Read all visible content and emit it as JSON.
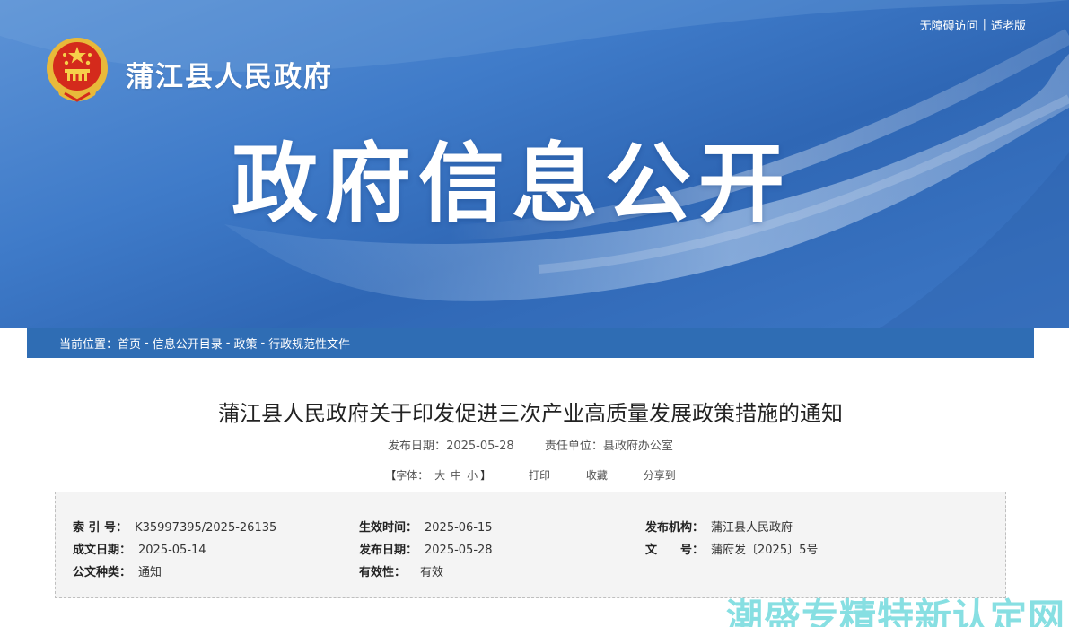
{
  "header": {
    "accessibility_link": "无障碍访问",
    "separator": "|",
    "elder_link": "适老版",
    "site_name": "蒲江县人民政府",
    "hero_title": "政府信息公开",
    "emblem_icon": "national-emblem-icon"
  },
  "breadcrumb": {
    "label": "当前位置：",
    "items": [
      "首页",
      "信息公开目录",
      "政策",
      "行政规范性文件"
    ],
    "separator": "-"
  },
  "article": {
    "title": "蒲江县人民政府关于印发促进三次产业高质量发展政策措施的通知",
    "publish_date_label": "发布日期：",
    "publish_date": "2025-05-28",
    "dept_label": "责任单位：",
    "dept": "县政府办公室"
  },
  "tools": {
    "open_bracket": "【",
    "font_label": "字体：",
    "sizes": [
      "大",
      "中",
      "小"
    ],
    "close_bracket": "】",
    "print": "打印",
    "favorite": "收藏",
    "share": "分享到"
  },
  "info": {
    "index_label": "索 引 号：",
    "index_value": "K35997395/2025-26135",
    "effective_label": "生效时间：",
    "effective_value": "2025-06-15",
    "issuer_label": "发布机构：",
    "issuer_value": "蒲江县人民政府",
    "written_label": "成文日期：",
    "written_value": "2025-05-14",
    "publish_label": "发布日期：",
    "publish_value": "2025-05-28",
    "docno_label": "文　　号：",
    "docno_value": "蒲府发〔2025〕5号",
    "type_label": "公文种类：",
    "type_value": "通知",
    "validity_label": "有效性：",
    "validity_value": "有效"
  },
  "watermark": "潮盛专精特新认定网",
  "colors": {
    "banner": "#3f7bc9",
    "breadcrumb_bg": "#2f6db4",
    "watermark": "#25c5cb"
  }
}
